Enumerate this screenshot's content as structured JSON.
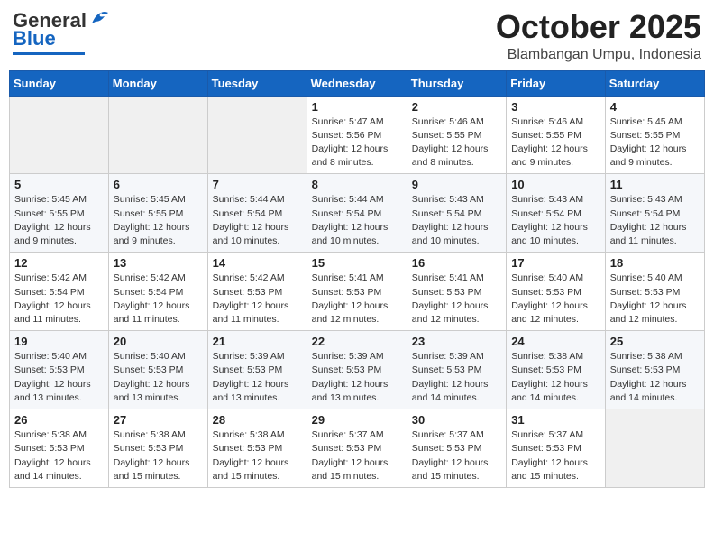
{
  "header": {
    "logo_general": "General",
    "logo_blue": "Blue",
    "month": "October 2025",
    "location": "Blambangan Umpu, Indonesia"
  },
  "weekdays": [
    "Sunday",
    "Monday",
    "Tuesday",
    "Wednesday",
    "Thursday",
    "Friday",
    "Saturday"
  ],
  "weeks": [
    [
      {
        "day": "",
        "info": ""
      },
      {
        "day": "",
        "info": ""
      },
      {
        "day": "",
        "info": ""
      },
      {
        "day": "1",
        "info": "Sunrise: 5:47 AM\nSunset: 5:56 PM\nDaylight: 12 hours\nand 8 minutes."
      },
      {
        "day": "2",
        "info": "Sunrise: 5:46 AM\nSunset: 5:55 PM\nDaylight: 12 hours\nand 8 minutes."
      },
      {
        "day": "3",
        "info": "Sunrise: 5:46 AM\nSunset: 5:55 PM\nDaylight: 12 hours\nand 9 minutes."
      },
      {
        "day": "4",
        "info": "Sunrise: 5:45 AM\nSunset: 5:55 PM\nDaylight: 12 hours\nand 9 minutes."
      }
    ],
    [
      {
        "day": "5",
        "info": "Sunrise: 5:45 AM\nSunset: 5:55 PM\nDaylight: 12 hours\nand 9 minutes."
      },
      {
        "day": "6",
        "info": "Sunrise: 5:45 AM\nSunset: 5:55 PM\nDaylight: 12 hours\nand 9 minutes."
      },
      {
        "day": "7",
        "info": "Sunrise: 5:44 AM\nSunset: 5:54 PM\nDaylight: 12 hours\nand 10 minutes."
      },
      {
        "day": "8",
        "info": "Sunrise: 5:44 AM\nSunset: 5:54 PM\nDaylight: 12 hours\nand 10 minutes."
      },
      {
        "day": "9",
        "info": "Sunrise: 5:43 AM\nSunset: 5:54 PM\nDaylight: 12 hours\nand 10 minutes."
      },
      {
        "day": "10",
        "info": "Sunrise: 5:43 AM\nSunset: 5:54 PM\nDaylight: 12 hours\nand 10 minutes."
      },
      {
        "day": "11",
        "info": "Sunrise: 5:43 AM\nSunset: 5:54 PM\nDaylight: 12 hours\nand 11 minutes."
      }
    ],
    [
      {
        "day": "12",
        "info": "Sunrise: 5:42 AM\nSunset: 5:54 PM\nDaylight: 12 hours\nand 11 minutes."
      },
      {
        "day": "13",
        "info": "Sunrise: 5:42 AM\nSunset: 5:54 PM\nDaylight: 12 hours\nand 11 minutes."
      },
      {
        "day": "14",
        "info": "Sunrise: 5:42 AM\nSunset: 5:53 PM\nDaylight: 12 hours\nand 11 minutes."
      },
      {
        "day": "15",
        "info": "Sunrise: 5:41 AM\nSunset: 5:53 PM\nDaylight: 12 hours\nand 12 minutes."
      },
      {
        "day": "16",
        "info": "Sunrise: 5:41 AM\nSunset: 5:53 PM\nDaylight: 12 hours\nand 12 minutes."
      },
      {
        "day": "17",
        "info": "Sunrise: 5:40 AM\nSunset: 5:53 PM\nDaylight: 12 hours\nand 12 minutes."
      },
      {
        "day": "18",
        "info": "Sunrise: 5:40 AM\nSunset: 5:53 PM\nDaylight: 12 hours\nand 12 minutes."
      }
    ],
    [
      {
        "day": "19",
        "info": "Sunrise: 5:40 AM\nSunset: 5:53 PM\nDaylight: 12 hours\nand 13 minutes."
      },
      {
        "day": "20",
        "info": "Sunrise: 5:40 AM\nSunset: 5:53 PM\nDaylight: 12 hours\nand 13 minutes."
      },
      {
        "day": "21",
        "info": "Sunrise: 5:39 AM\nSunset: 5:53 PM\nDaylight: 12 hours\nand 13 minutes."
      },
      {
        "day": "22",
        "info": "Sunrise: 5:39 AM\nSunset: 5:53 PM\nDaylight: 12 hours\nand 13 minutes."
      },
      {
        "day": "23",
        "info": "Sunrise: 5:39 AM\nSunset: 5:53 PM\nDaylight: 12 hours\nand 14 minutes."
      },
      {
        "day": "24",
        "info": "Sunrise: 5:38 AM\nSunset: 5:53 PM\nDaylight: 12 hours\nand 14 minutes."
      },
      {
        "day": "25",
        "info": "Sunrise: 5:38 AM\nSunset: 5:53 PM\nDaylight: 12 hours\nand 14 minutes."
      }
    ],
    [
      {
        "day": "26",
        "info": "Sunrise: 5:38 AM\nSunset: 5:53 PM\nDaylight: 12 hours\nand 14 minutes."
      },
      {
        "day": "27",
        "info": "Sunrise: 5:38 AM\nSunset: 5:53 PM\nDaylight: 12 hours\nand 15 minutes."
      },
      {
        "day": "28",
        "info": "Sunrise: 5:38 AM\nSunset: 5:53 PM\nDaylight: 12 hours\nand 15 minutes."
      },
      {
        "day": "29",
        "info": "Sunrise: 5:37 AM\nSunset: 5:53 PM\nDaylight: 12 hours\nand 15 minutes."
      },
      {
        "day": "30",
        "info": "Sunrise: 5:37 AM\nSunset: 5:53 PM\nDaylight: 12 hours\nand 15 minutes."
      },
      {
        "day": "31",
        "info": "Sunrise: 5:37 AM\nSunset: 5:53 PM\nDaylight: 12 hours\nand 15 minutes."
      },
      {
        "day": "",
        "info": ""
      }
    ]
  ]
}
